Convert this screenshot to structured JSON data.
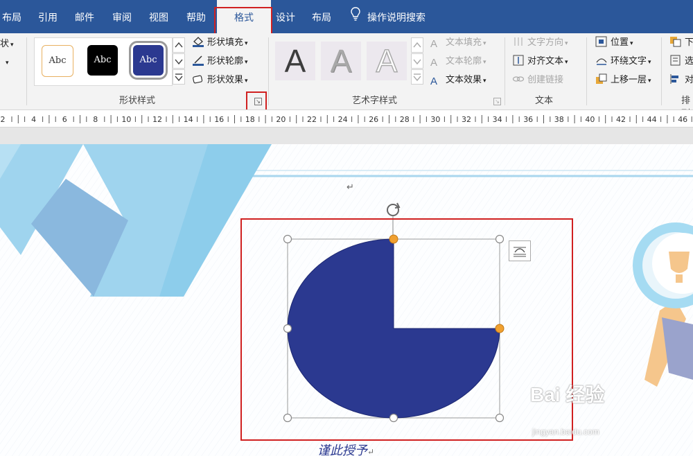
{
  "tabs": [
    {
      "label": "布局",
      "active": false
    },
    {
      "label": "引用",
      "active": false
    },
    {
      "label": "邮件",
      "active": false
    },
    {
      "label": "审阅",
      "active": false
    },
    {
      "label": "视图",
      "active": false
    },
    {
      "label": "帮助",
      "active": false
    },
    {
      "label": "格式",
      "active": true
    },
    {
      "label": "设计",
      "active": false
    },
    {
      "label": "布局",
      "active": false
    }
  ],
  "search": {
    "label": "操作说明搜索",
    "icon": "lightbulb-icon"
  },
  "ribbon": {
    "left_partial": {
      "line1": "状",
      "arrow": "▾"
    },
    "shape_styles": {
      "group_label": "形状样式",
      "presets": [
        {
          "label": "Abc",
          "style": "white-with-orange-border"
        },
        {
          "label": "Abc",
          "style": "black"
        },
        {
          "label": "Abc",
          "style": "navy-selected"
        }
      ],
      "fill": "形状填充",
      "outline": "形状轮廓",
      "effects": "形状效果"
    },
    "wordart_styles": {
      "group_label": "艺术字样式",
      "letter": "A",
      "text_fill": "文本填充",
      "text_outline": "文本轮廓",
      "text_effects": "文本效果"
    },
    "text_group": {
      "group_label": "文本",
      "direction": "文字方向",
      "align": "对齐文本",
      "link": "创建链接"
    },
    "arrange_group": {
      "group_label": "排列",
      "position": "位置",
      "wrap": "环绕文字",
      "bring_forward": "上移一层",
      "partial_right": [
        "下",
        "选",
        "对"
      ]
    }
  },
  "ruler": {
    "numbers": [
      "2",
      "4",
      "6",
      "8",
      "10",
      "12",
      "14",
      "16",
      "18",
      "20",
      "22",
      "24",
      "26",
      "28",
      "30",
      "32",
      "34",
      "36",
      "38",
      "40",
      "42",
      "44",
      "46"
    ]
  },
  "document": {
    "shape": {
      "type": "pie",
      "fill": "#2b3990"
    },
    "bottom_text": "谨此授予",
    "return_mark": "↵"
  },
  "watermark": {
    "main": "Bai 经验",
    "sub": "jingyan.baidu.com"
  },
  "colors": {
    "ribbon_blue": "#2b579a",
    "highlight_red": "#d02020",
    "shape_navy": "#2b3990",
    "handle_orange": "#f0a030"
  }
}
